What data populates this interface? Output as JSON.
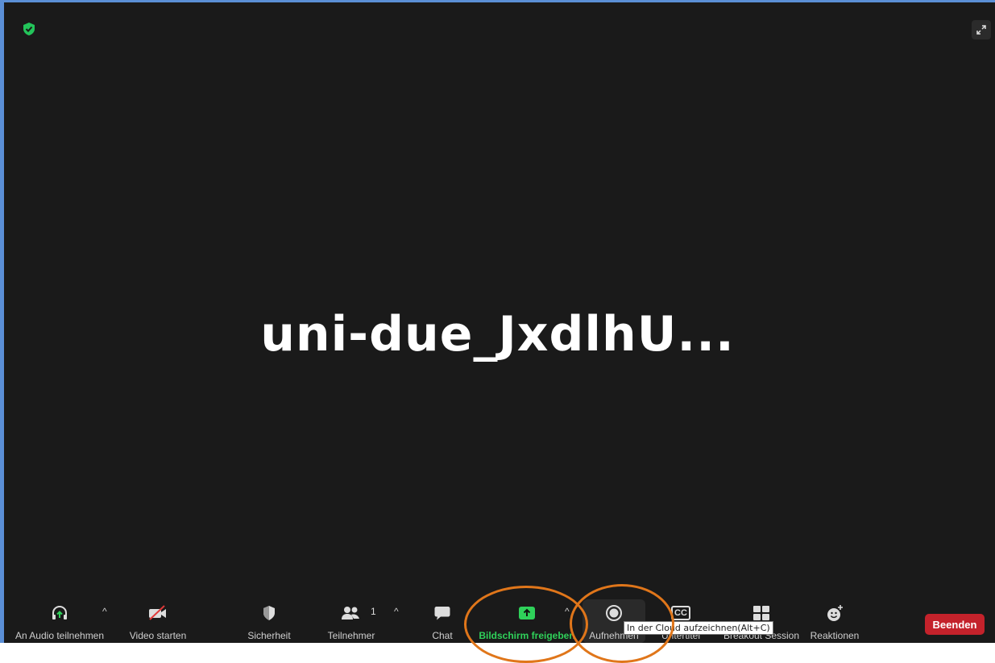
{
  "meeting": {
    "name": "uni-due_JxdlhU..."
  },
  "toolbar": {
    "audio_label": "An Audio teilnehmen",
    "video_label": "Video starten",
    "security_label": "Sicherheit",
    "participants_label": "Teilnehmer",
    "participants_count": "1",
    "chat_label": "Chat",
    "share_label": "Bildschirm freigeben",
    "record_label": "Aufnehmen",
    "subtitles_label": "Untertitel",
    "cc_text": "CC",
    "breakout_label": "Breakout Session",
    "reactions_label": "Reaktionen",
    "caret": "^"
  },
  "end_button": {
    "label": "Beenden"
  },
  "tooltip": {
    "text": "In der Cloud aufzeichnen(Alt+C)"
  },
  "colors": {
    "share_green": "#2fd15a",
    "end_red": "#c4222b",
    "annotation_orange": "#e0761a",
    "frame_blue": "#5b8fd6"
  },
  "icons": [
    "shield-check-icon",
    "expand-icon",
    "headphones-icon",
    "video-off-icon",
    "security-shield-icon",
    "participants-icon",
    "chat-bubble-icon",
    "share-screen-icon",
    "record-icon",
    "cc-icon",
    "breakout-grid-icon",
    "reactions-icon"
  ]
}
